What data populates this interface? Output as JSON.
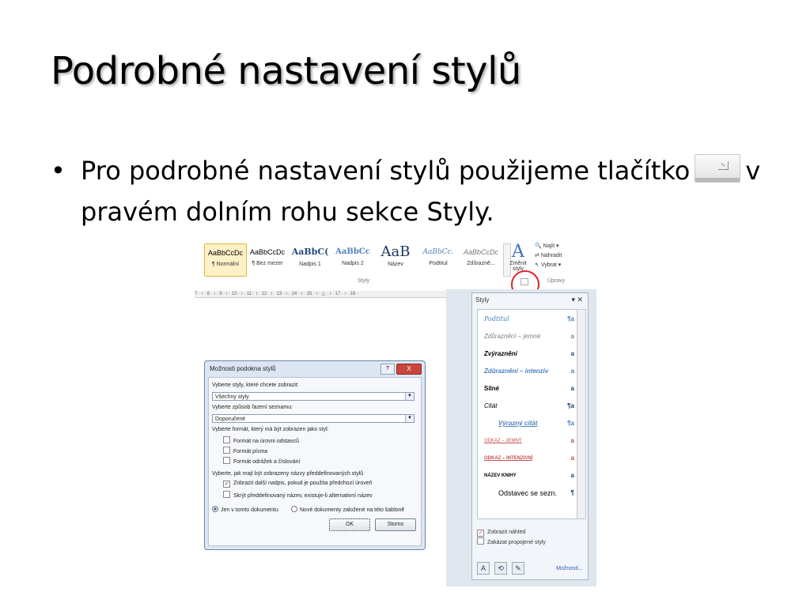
{
  "slide": {
    "title": "Podrobné nastavení stylů",
    "bullet_symbol": "•",
    "bullet_before": "Pro podrobné nastavení stylů použijeme tlačítko",
    "bullet_after": "v pravém dolním rohu sekce Styly."
  },
  "ribbon": {
    "styles": [
      {
        "sample": "AaBbCcDc",
        "name": "¶ Normální",
        "selected": true
      },
      {
        "sample": "AaBbCcDc",
        "name": "¶ Bez mezer"
      },
      {
        "sample": "AaBbC(",
        "name": "Nadpis 1"
      },
      {
        "sample": "AaBbCc",
        "name": "Nadpis 2"
      },
      {
        "sample": "AaB",
        "name": "Název"
      },
      {
        "sample": "AaBbCc.",
        "name": "Podtitul"
      },
      {
        "sample": "AaBbCcDc",
        "name": "Zdůrazně..."
      }
    ],
    "change_styles": "Změnit styly",
    "find": "Najít ▾",
    "replace": "Nahradit",
    "select": "Vybrat ▾",
    "group_styles": "Styly",
    "group_edit": "Úpravy"
  },
  "ruler_text": "7 · ı · 8 · ı · 9 · ı · 10 · ı · 11 · ı · 12 · ı · 13 · ı · 14 · ı · 15 · ı · △ · ı · 17 · ı · 18 ·",
  "pane": {
    "title": "Styly",
    "close": "▾ ✕",
    "items": [
      {
        "label": "Podtitul",
        "mark": "¶a",
        "color": "#4f81bd"
      },
      {
        "label": "Zdůraznění – jemné",
        "mark": "a",
        "color": "#7f7f7f"
      },
      {
        "label": "Zvýraznění",
        "mark": "a",
        "color": "#000000"
      },
      {
        "label": "Zdůraznění – intenziv",
        "mark": "a",
        "color": "#4f81bd"
      },
      {
        "label": "Silné",
        "mark": "a",
        "color": "#000000"
      },
      {
        "label": "Citát",
        "mark": "¶a",
        "color": "#000000"
      },
      {
        "label": "Výrazný citát",
        "mark": "¶a",
        "color": "#4f81bd"
      },
      {
        "label": "Odkaz – jemný",
        "mark": "a",
        "color": "#c0504d"
      },
      {
        "label": "Odkaz – intenzivní",
        "mark": "a",
        "color": "#c0504d"
      },
      {
        "label": "Název knihy",
        "mark": "a",
        "color": "#000000"
      },
      {
        "label": "Odstavec se sezn.",
        "mark": "¶",
        "color": "#000000"
      }
    ],
    "show_preview": "Zobrazit náhled",
    "disable_linked": "Zakázat propojené styly",
    "options_link": "Možnosti..."
  },
  "dialog": {
    "title": "Možnosti podokna stylů",
    "help": "?",
    "close": "X",
    "label_show": "Vyberte styly, které chcete zobrazit:",
    "select_show": "Všechny styly",
    "label_sort": "Vyberte způsob řazení seznamu:",
    "select_sort": "Doporučené",
    "label_format": "Vyberte formát, který má být zobrazen jako styl:",
    "cb_paragraph": "Formát na úrovni odstavců",
    "cb_font": "Formát písma",
    "cb_bullets": "Formát odrážek a číslování",
    "label_builtin": "Vyberte, jak mají být zobrazeny názvy předdefinovaných stylů",
    "cb_next_heading": "Zobrazit další nadpis, pokud je použita předchozí úroveň",
    "cb_hide_builtin": "Skrýt předdefinovaný název, existuje-li alternativní název",
    "radio_doc": "Jen v tomto dokumentu",
    "radio_template": "Nové dokumenty založené na této šabloně",
    "ok": "OK",
    "cancel": "Storno"
  },
  "colors": {
    "highlight_circle": "#e32025",
    "accent": "#4f81bd"
  }
}
